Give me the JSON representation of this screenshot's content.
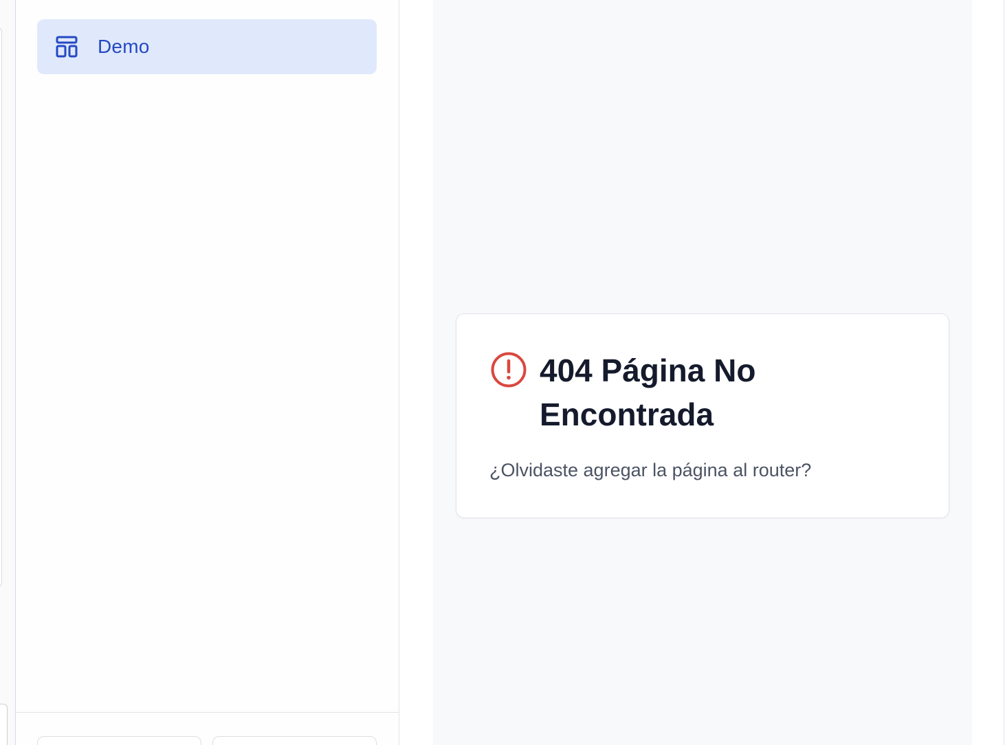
{
  "sidebar": {
    "items": [
      {
        "label": "Demo",
        "icon": "layout-dashboard-icon",
        "active": true
      }
    ],
    "footer_buttons": [
      "",
      ""
    ]
  },
  "error_card": {
    "title": "404 Página No Encontrada",
    "message": "¿Olvidaste agregar la página al router?",
    "icon": "alert-circle-icon"
  },
  "colors": {
    "accent": "#2548c4",
    "active_bg": "#dfe9fb",
    "error_icon": "#d9483f",
    "title": "#151b2c",
    "muted_text": "#4b5363",
    "content_bg": "#f8f9fb"
  }
}
